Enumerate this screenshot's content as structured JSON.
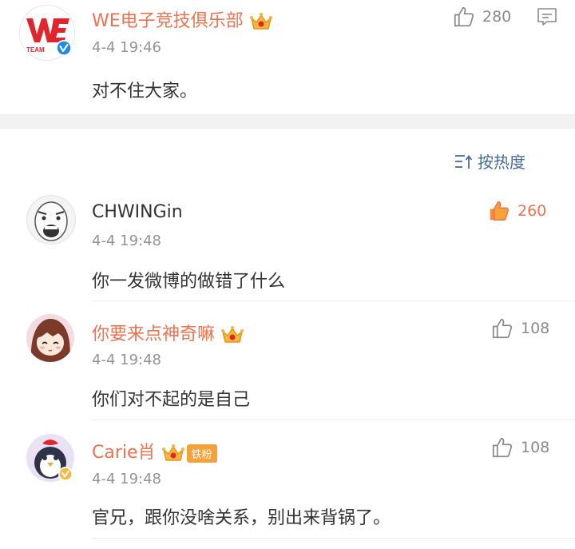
{
  "post": {
    "author": "WE电子竞技俱乐部",
    "avatar_text": "TEAM",
    "time": "4-4 19:46",
    "text": "对不住大家。",
    "likes": "280"
  },
  "sort": {
    "label": "按热度"
  },
  "comments": [
    {
      "author": "CHWINGin",
      "time": "4-4 19:48",
      "text": "你一发微博的做错了什么",
      "likes": "260"
    },
    {
      "author": "你要来点神奇嘛",
      "time": "4-4 19:48",
      "text": "你们对不起的是自己",
      "likes": "108"
    },
    {
      "author": "Carie肖",
      "badge": "铁粉",
      "time": "4-4 19:48",
      "text": "官兄，跟你没啥关系，别出来背锅了。",
      "likes": "108"
    }
  ],
  "colors": {
    "accent": "#eb7350",
    "link": "#4a6b94",
    "muted": "#939393"
  }
}
